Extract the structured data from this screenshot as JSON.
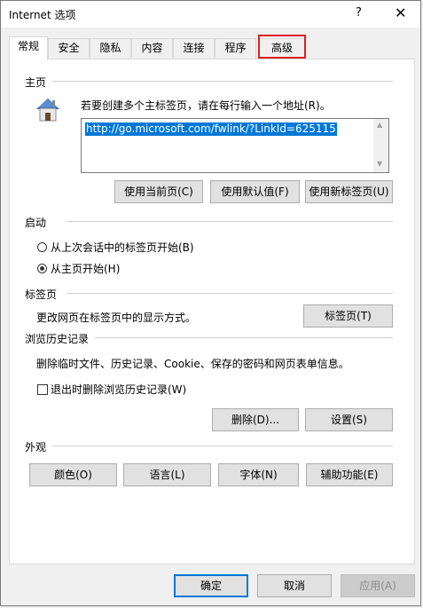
{
  "window": {
    "title": "Internet 选项",
    "help_glyph": "?",
    "close_glyph": "✕"
  },
  "tabs": [
    {
      "label": "常规",
      "active": true
    },
    {
      "label": "安全"
    },
    {
      "label": "隐私"
    },
    {
      "label": "内容"
    },
    {
      "label": "连接"
    },
    {
      "label": "程序"
    },
    {
      "label": "高级",
      "highlighted": true
    }
  ],
  "home": {
    "section": "主页",
    "instruction": "若要创建多个主标签页，请在每行输入一个地址(R)。",
    "url": "http://go.microsoft.com/fwlink/?LinkId=625115",
    "use_current": "使用当前页(C)",
    "use_default": "使用默认值(F)",
    "use_new_tab": "使用新标签页(U)"
  },
  "startup": {
    "section": "启动",
    "option_last_session": "从上次会话中的标签页开始(B)",
    "option_home": "从主页开始(H)",
    "selected": "home"
  },
  "tabs_section": {
    "section": "标签页",
    "description": "更改网页在标签页中的显示方式。",
    "button": "标签页(T)"
  },
  "history": {
    "section": "浏览历史记录",
    "description": "删除临时文件、历史记录、Cookie、保存的密码和网页表单信息。",
    "checkbox_label": "退出时删除浏览历史记录(W)",
    "checked": false,
    "delete_button": "删除(D)...",
    "settings_button": "设置(S)"
  },
  "appearance": {
    "section": "外观",
    "colors": "颜色(O)",
    "languages": "语言(L)",
    "fonts": "字体(N)",
    "accessibility": "辅助功能(E)"
  },
  "footer": {
    "ok": "确定",
    "cancel": "取消",
    "apply": "应用(A)"
  },
  "colors": {
    "selection": "#0078d7",
    "highlight_box": "#e02020",
    "house_roof": "#2e5fa8"
  }
}
